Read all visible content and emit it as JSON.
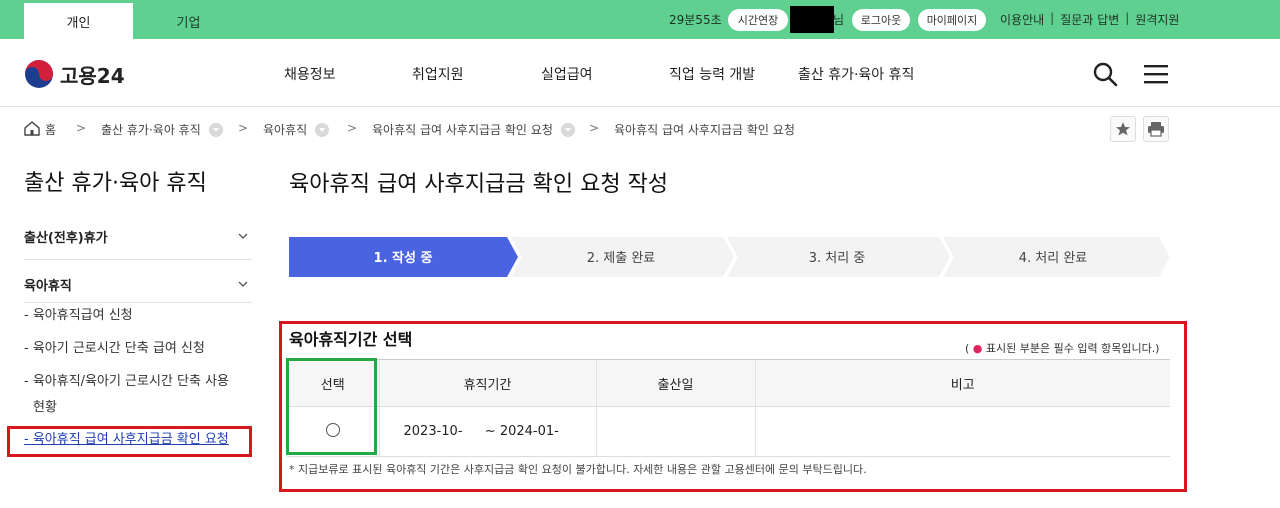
{
  "topbar": {
    "tab_personal": "개인",
    "tab_company": "기업",
    "timer": "29분55초",
    "extend_label": "시간연장",
    "redacted_tail": "님",
    "logout_label": "로그아웃",
    "mypage_label": "마이페이지",
    "links": [
      "이용안내",
      "질문과 답변",
      "원격지원"
    ],
    "bg_color": "#5fd08f"
  },
  "header": {
    "logo_text": "고용24",
    "nav": [
      "채용정보",
      "취업지원",
      "실업급여",
      "직업 능력 개발",
      "출산 휴가·육아 휴직"
    ],
    "icons": [
      "search-icon",
      "menu-icon"
    ]
  },
  "breadcrumb": {
    "home": "홈",
    "items": [
      "출산 휴가·육아 휴직",
      "육아휴직",
      "육아휴직 급여 사후지급금 확인 요청",
      "육아휴직 급여 사후지급금 확인 요청"
    ],
    "utils": [
      "star-icon",
      "print-icon"
    ]
  },
  "side": {
    "title": "출산 휴가·육아 휴직",
    "groups": [
      "출산(전후)휴가",
      "육아휴직"
    ],
    "items": [
      "- 육아휴직급여 신청",
      "- 육아기 근로시간 단축 급여 신청",
      "- 육아휴직/육아기 근로시간 단축 사용",
      "현황",
      "- 육아휴직 급여 사후지급금 확인 요청"
    ]
  },
  "main": {
    "title": "육아휴직 급여 사후지급금 확인 요청 작성",
    "steps": [
      "1. 작성 중",
      "2. 제출 완료",
      "3. 처리 중",
      "4. 처리 완료"
    ],
    "active_step_color": "#4a63e0",
    "section_title": "육아휴직기간 선택",
    "required_note_pre": "( ",
    "required_dot": "●",
    "required_note": " 표시된 부분은 필수 입력 항목입니다.)",
    "table": {
      "headers": [
        "선택",
        "휴직기간",
        "출산일",
        "비고"
      ],
      "rows": [
        {
          "period_start": "2023-10-",
          "period_end": "~ 2024-01-",
          "birth_date": "",
          "note": ""
        }
      ]
    },
    "foot_note": "* 지급보류로 표시된 육아휴직 기간은 사후지급금 확인 요청이 불가합니다. 자세한 내용은 관할 고용센터에 문의 부탁드립니다."
  }
}
